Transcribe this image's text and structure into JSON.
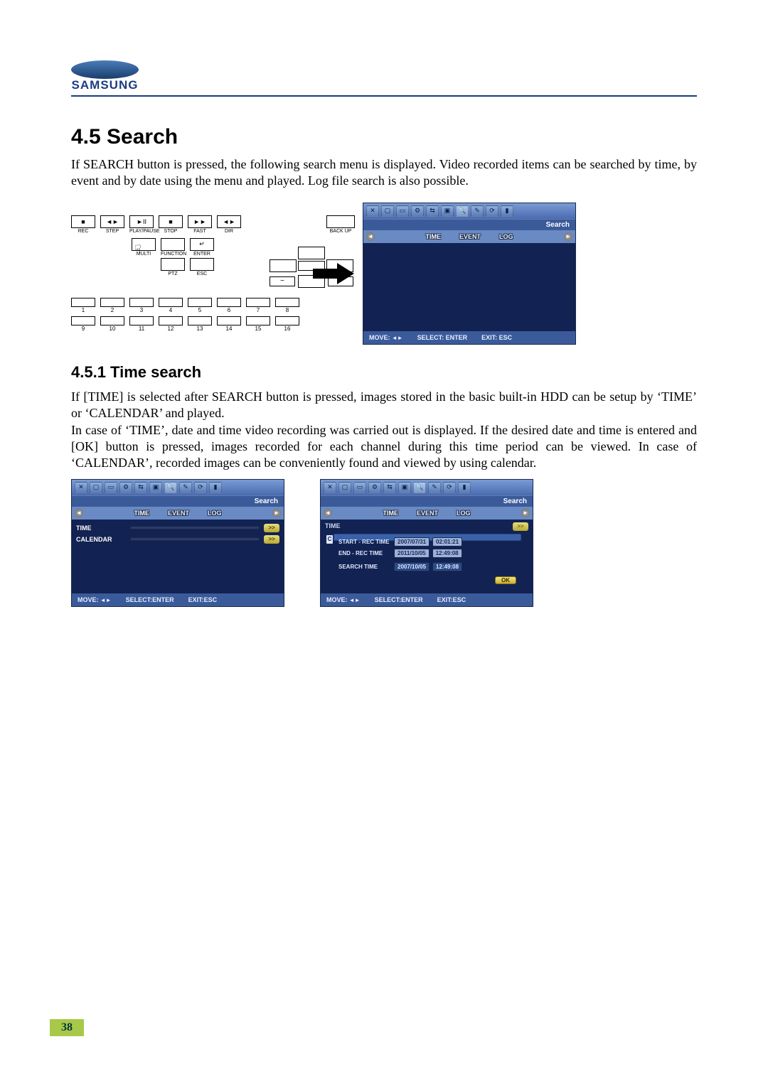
{
  "logo": {
    "brand": "SAMSUNG"
  },
  "headings": {
    "h1": "4.5 Search",
    "h2": "4.5.1 Time search"
  },
  "paragraphs": {
    "p1": "If SEARCH button is pressed, the following search menu is displayed. Video recorded items can be searched by time, by event and by date using the menu and played. Log file search is also possible.",
    "p2": "If [TIME] is selected after SEARCH button is pressed, images stored in the basic built-in HDD can be setup by ‘TIME’ or ‘CALENDAR’ and played.",
    "p3": "In case of ‘TIME’, date and time video recording was carried out is displayed. If the desired date and time is entered and [OK] button is pressed, images recorded for each channel during this time period can be viewed. In case of ‘CALENDAR’, recorded images can be conveniently found and viewed by using calendar."
  },
  "remote": {
    "top_row": [
      {
        "glyph": "■",
        "label": "REC"
      },
      {
        "glyph": "◄►",
        "label": "STEP"
      },
      {
        "glyph": "►II",
        "label": "PLAY/PAUSE"
      },
      {
        "glyph": "■",
        "label": "STOP"
      },
      {
        "glyph": "►►",
        "label": "FAST"
      },
      {
        "glyph": "◄►",
        "label": "DIR"
      }
    ],
    "backup": {
      "label": "BACK UP"
    },
    "mid_col1": [
      {
        "glyph": "",
        "label": "MULTI"
      }
    ],
    "mid_col2": [
      {
        "glyph": "",
        "label": "FUNCTION"
      },
      {
        "glyph": "",
        "label": "PTZ"
      }
    ],
    "mid_col3": [
      {
        "glyph": "↵",
        "label": "ENTER"
      },
      {
        "glyph": "",
        "label": "ESC"
      }
    ],
    "minus": "−",
    "plus": "+",
    "numbers_row1": [
      "1",
      "2",
      "3",
      "4",
      "5",
      "6",
      "7",
      "8"
    ],
    "numbers_row2": [
      "9",
      "10",
      "11",
      "12",
      "13",
      "14",
      "15",
      "16"
    ]
  },
  "dvr_common": {
    "title": "Search",
    "tabs": [
      "TIME",
      "EVENT",
      "LOG"
    ],
    "footer": {
      "move": "MOVE:",
      "select": "SELECT: ENTER",
      "exit": "EXIT: ESC"
    },
    "footer2": {
      "move": "MOVE:",
      "select": "SELECT:ENTER",
      "exit": "EXIT:ESC"
    }
  },
  "dvr_sm1": {
    "rows": [
      {
        "label": "TIME",
        "go": ">>"
      },
      {
        "label": "CALENDAR",
        "go": ">>"
      }
    ]
  },
  "dvr_sm2": {
    "subhead": "TIME",
    "go": ">>",
    "c": "C",
    "rows": [
      {
        "label": "START - REC TIME",
        "date": "2007/07/31",
        "time": "02:01:21"
      },
      {
        "label": "END - REC TIME",
        "date": "2011/10/05",
        "time": "12:49:08"
      },
      {
        "label": "SEARCH TIME",
        "date": "2007/10/05",
        "time": "12:49:08"
      }
    ],
    "ok": "OK"
  },
  "page_number": "38"
}
